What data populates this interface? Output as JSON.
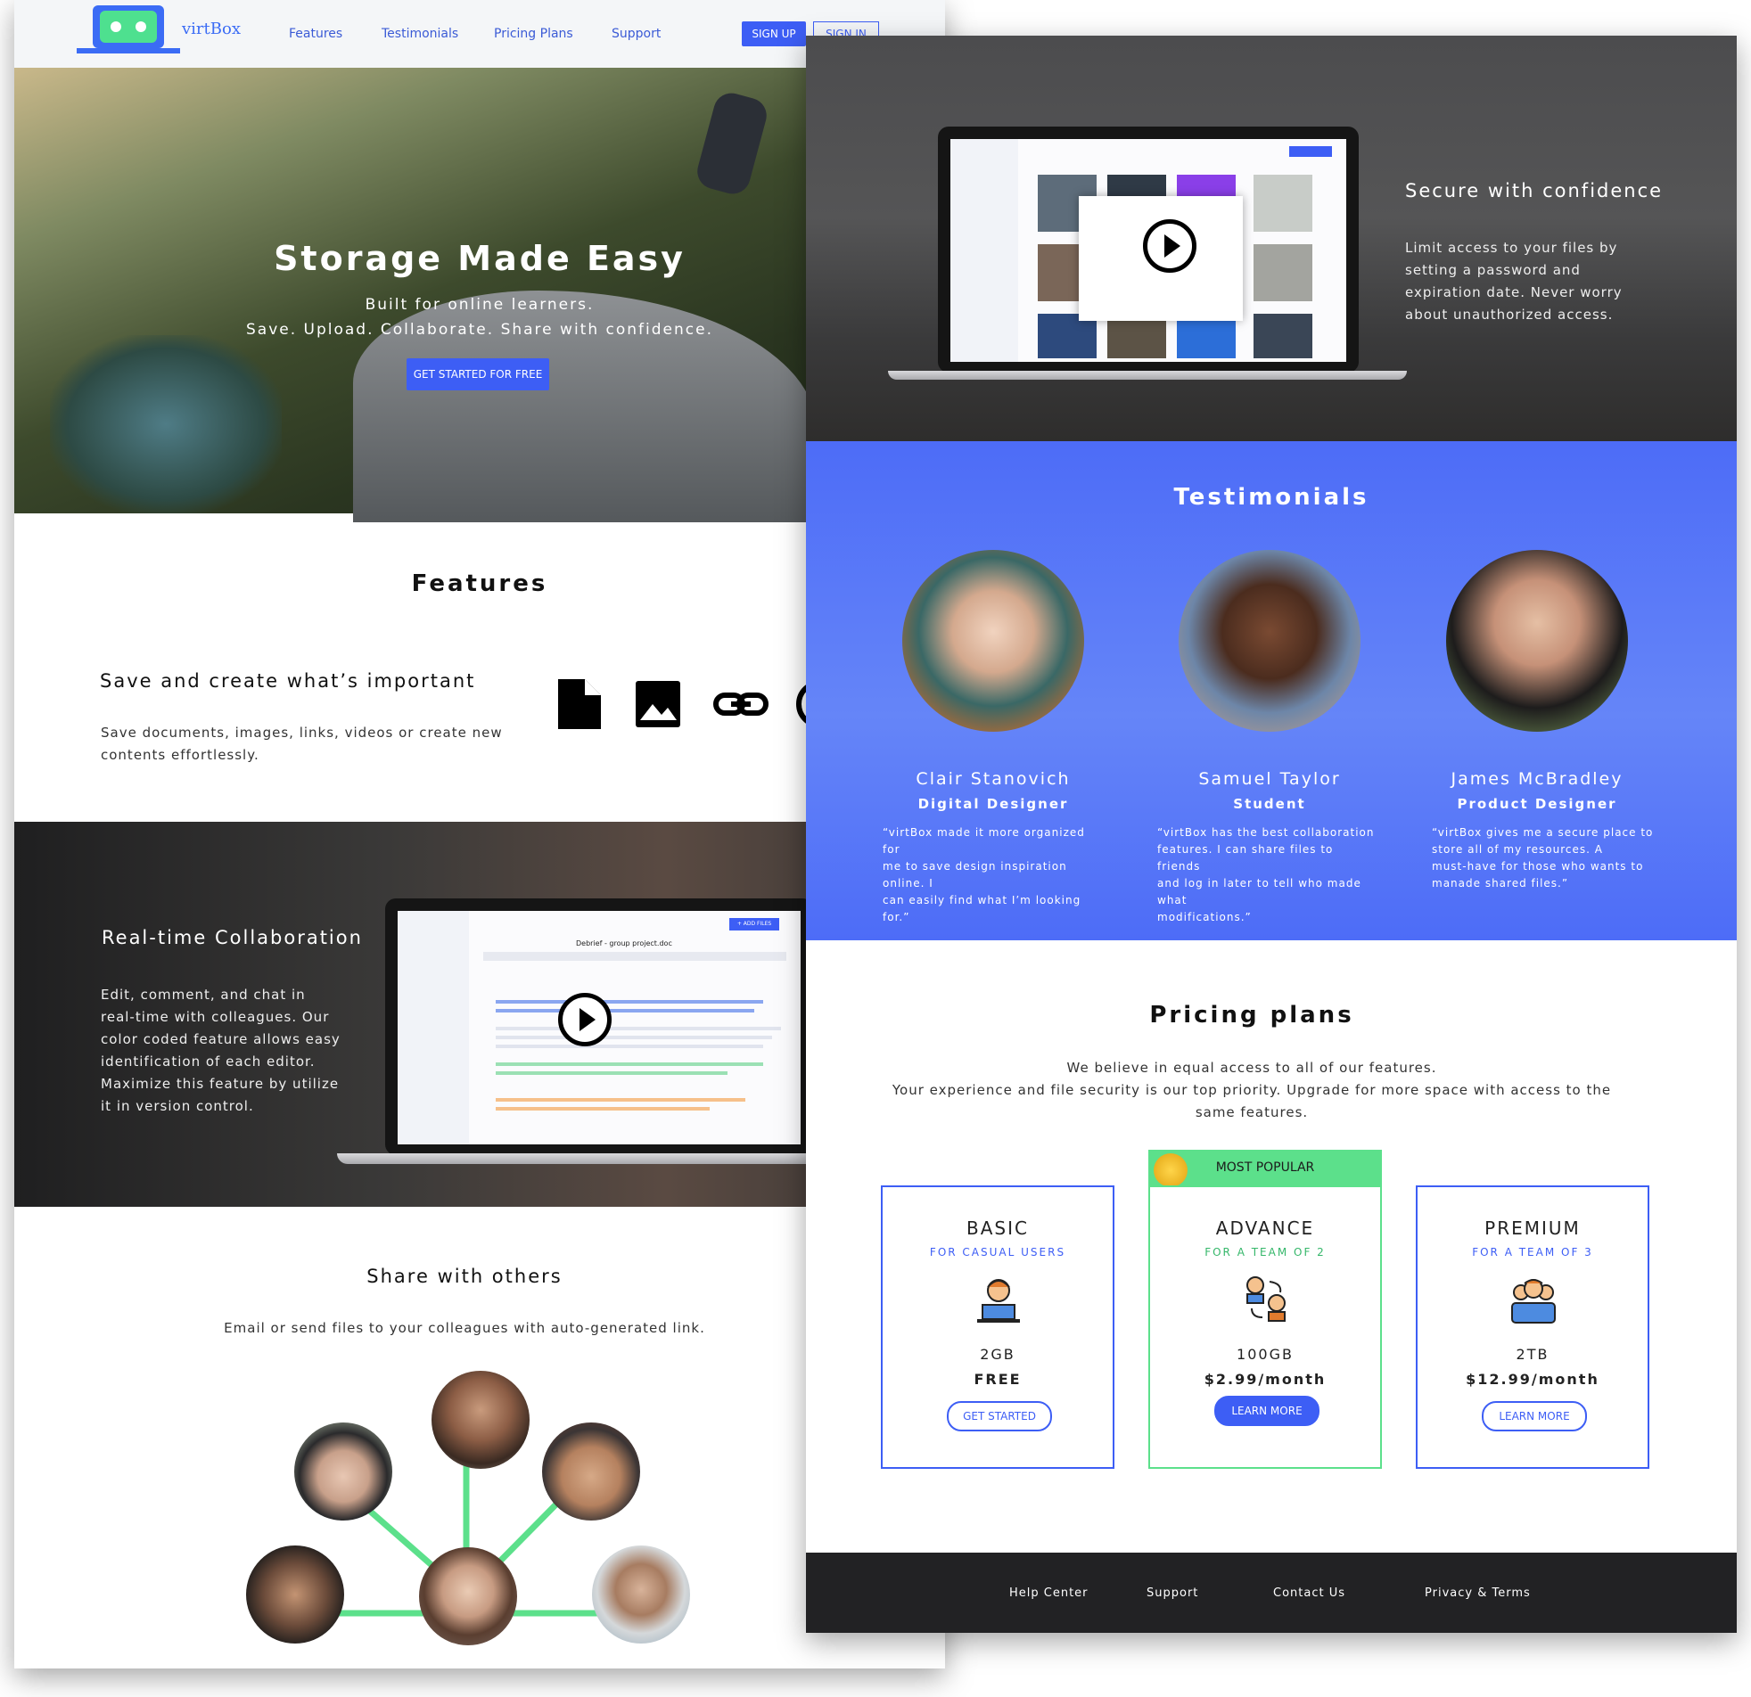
{
  "nav": {
    "brand": "virtBox",
    "links": [
      "Features",
      "Testimonials",
      "Pricing Plans",
      "Support"
    ],
    "signup": "SIGN UP",
    "signin": "SIGN IN"
  },
  "hero": {
    "title": "Storage Made Easy",
    "line1": "Built for online learners.",
    "line2": "Save. Upload. Collaborate. Share with confidence.",
    "cta": "GET STARTED FOR FREE"
  },
  "features": {
    "heading": "Features",
    "save": {
      "title": "Save and create what’s important",
      "text_line1": "Save documents, images, links, videos or create new",
      "text_line2": "contents effortlessly.",
      "icons": [
        "document-icon",
        "image-icon",
        "link-icon",
        "video-icon"
      ]
    },
    "collab": {
      "title": "Real-time Collaboration",
      "lines": [
        "Edit, comment, and chat in",
        "real-time with colleagues. Our",
        "color coded feature allows easy",
        "identification of each editor.",
        "Maximize this feature by utilize",
        "it in version control."
      ],
      "doc_title": "Debrief - group project.doc",
      "add_files": "+ ADD FILES"
    },
    "share": {
      "title": "Share with others",
      "text": "Email or send files to your colleagues with auto-generated link."
    }
  },
  "secure": {
    "title": "Secure with confidence",
    "lines": [
      "Limit access to your files by",
      "setting a password and",
      "expiration date. Never worry",
      "about unauthorized access."
    ]
  },
  "testimonials": {
    "heading": "Testimonials",
    "people": [
      {
        "name": "Clair Stanovich",
        "role": "Digital Designer",
        "quote": [
          "“virtBox made it more organized for",
          "me to save design inspiration online. I",
          "can easily find what I’m looking for.”"
        ]
      },
      {
        "name": "Samuel Taylor",
        "role": "Student",
        "quote": [
          "“virtBox has the best collaboration",
          "features. I can share files to friends",
          "and log in later to tell who made what",
          "modifications.”"
        ]
      },
      {
        "name": "James McBradley",
        "role": "Product Designer",
        "quote": [
          "“virtBox gives me a secure place to",
          "store all of my resources. A",
          "must-have for those who wants to",
          "manade shared files.”"
        ]
      }
    ]
  },
  "pricing": {
    "heading": "Pricing plans",
    "intro": [
      "We believe in equal access to all of our features.",
      "Your experience and file security is our top priority. Upgrade for more space with access to the",
      "same features."
    ],
    "most_popular": "MOST POPULAR",
    "plans": [
      {
        "name": "BASIC",
        "sub": "FOR CASUAL USERS",
        "storage": "2GB",
        "price": "FREE",
        "button": "GET STARTED",
        "icon": "single-user-icon"
      },
      {
        "name": "ADVANCE",
        "sub": "FOR A TEAM OF 2",
        "storage": "100GB",
        "price": "$2.99/month",
        "button": "LEARN MORE",
        "icon": "two-users-icon"
      },
      {
        "name": "PREMIUM",
        "sub": "FOR A TEAM OF 3",
        "storage": "2TB",
        "price": "$12.99/month",
        "button": "LEARN MORE",
        "icon": "team-icon"
      }
    ]
  },
  "footer": {
    "links": [
      "Help Center",
      "Support",
      "Contact Us",
      "Privacy & Terms"
    ]
  },
  "colors": {
    "accent": "#3d5ef5",
    "green": "#5ce08b",
    "footer": "#222224"
  }
}
